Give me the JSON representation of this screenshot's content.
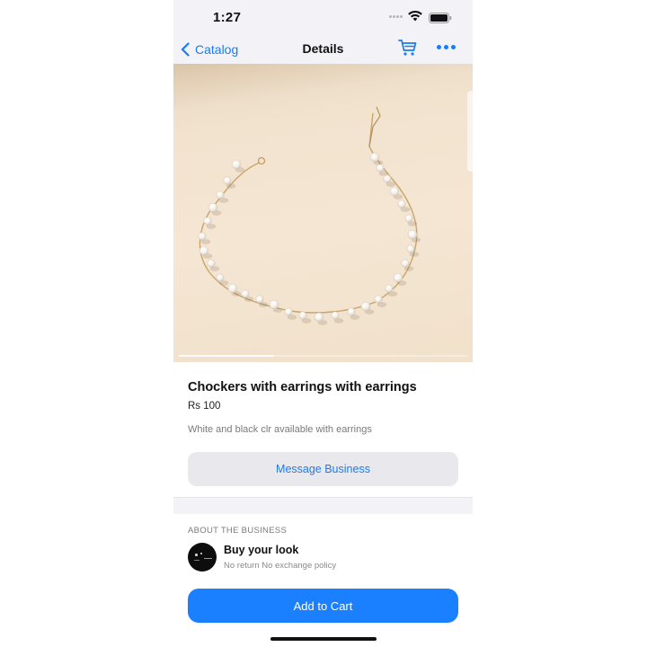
{
  "status_bar": {
    "time": "1:27"
  },
  "nav": {
    "back_label": "Catalog",
    "title": "Details",
    "cart_icon": "cart-icon",
    "more_icon": "more-icon"
  },
  "product": {
    "image_icon": "pearl-choker-photo",
    "image_carousel_progress": 0.33,
    "title": "Chockers with earrings with earrings",
    "price": "Rs 100",
    "description": "White and black clr available with earrings"
  },
  "actions": {
    "message_label": "Message Business",
    "add_to_cart_label": "Add to Cart"
  },
  "business": {
    "section_label": "ABOUT THE BUSINESS",
    "name": "Buy your look",
    "policy": "No return No exchange policy"
  },
  "colors": {
    "accent": "#1a7cf5",
    "primary_button": "#1a80ff",
    "background_gray": "#f2f2f7"
  }
}
